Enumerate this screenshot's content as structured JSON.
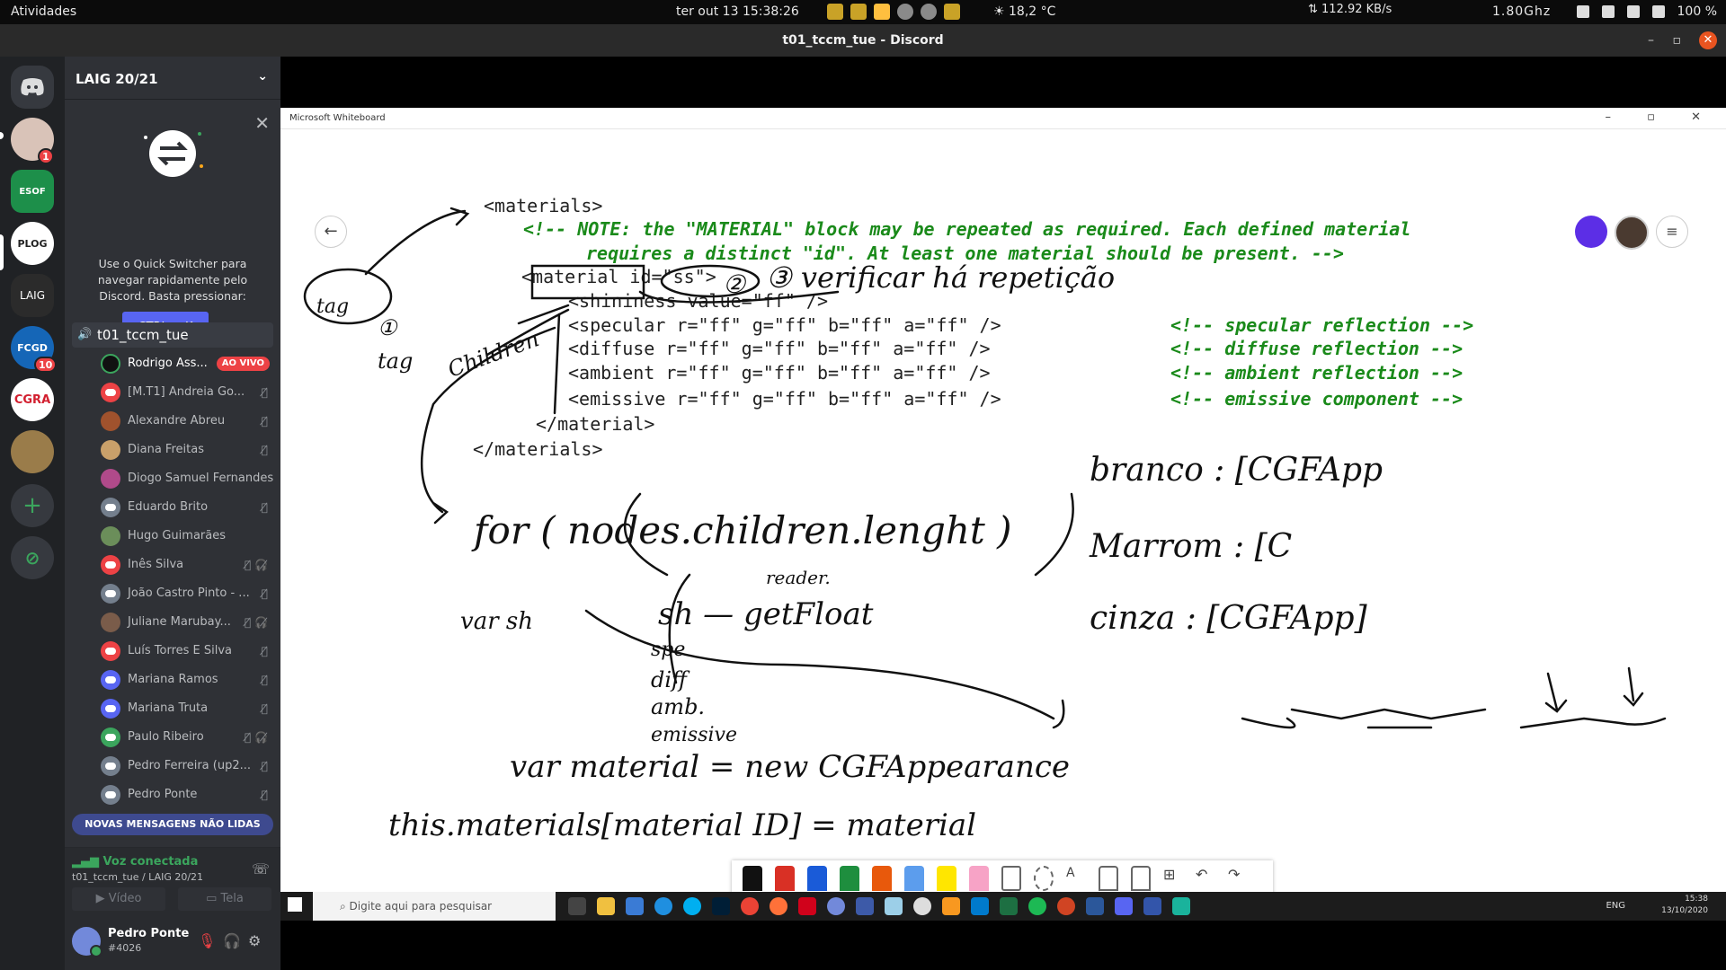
{
  "topbar": {
    "activities": "Atividades",
    "clock": "ter out 13  15:38:26",
    "weather": "☀ 18,2 °C",
    "net_speed": "⇅ 112.92 KB/s",
    "cpu": "1.80Ghz",
    "battery": "100 %"
  },
  "window": {
    "title": "t01_tccm_tue - Discord"
  },
  "rail": {
    "servers": [
      {
        "label": "",
        "badge": "1"
      },
      {
        "label": "ESOF"
      },
      {
        "label": "PLOG"
      },
      {
        "label": "LAIG"
      },
      {
        "label": "FCGD",
        "badge": "10"
      },
      {
        "label": "CGRA"
      },
      {
        "label": ""
      }
    ]
  },
  "sidebar": {
    "guild_name": "LAIG 20/21",
    "switcher": {
      "text": "Use o Quick Switcher para navegar rapidamente pelo Discord. Basta pressionar:",
      "button": "CTRL + K"
    },
    "voice_channel": "t01_tccm_tue",
    "live_label": "AO VIVO",
    "voice_users": [
      {
        "name": "Rodrigo Ass...",
        "live": true,
        "color": "#111111"
      },
      {
        "name": "[M.T1] Andreia Go...",
        "color": "#ed4245"
      },
      {
        "name": "Alexandre Abreu",
        "color": "#a0522d"
      },
      {
        "name": "Diana Freitas",
        "color": "#c9a06a"
      },
      {
        "name": "Diogo Samuel Fernandes",
        "color": "#b04a8a"
      },
      {
        "name": "Eduardo Brito",
        "color": "#747f8d"
      },
      {
        "name": "Hugo Guimarães",
        "color": "#6b8e5a"
      },
      {
        "name": "Inês Silva",
        "color": "#ed4245"
      },
      {
        "name": "João Castro Pinto - ...",
        "color": "#747f8d"
      },
      {
        "name": "Juliane Marubay...",
        "color": "#7a5c4a"
      },
      {
        "name": "Luís Torres E Silva",
        "color": "#ed4245"
      },
      {
        "name": "Mariana Ramos",
        "color": "#5865f2"
      },
      {
        "name": "Mariana Truta",
        "color": "#5865f2"
      },
      {
        "name": "Paulo Ribeiro",
        "color": "#3ba55d"
      },
      {
        "name": "Pedro Ferreira (up2...",
        "color": "#747f8d"
      },
      {
        "name": "Pedro Ponte",
        "color": "#747f8d"
      }
    ],
    "new_messages": "NOVAS MENSAGENS NÃO LIDAS",
    "voice_panel": {
      "status": "Voz conectada",
      "path": "t01_tccm_tue / LAIG 20/21",
      "video": "Vídeo",
      "screen": "Tela"
    },
    "user": {
      "name": "Pedro Ponte",
      "tag": "#4026"
    }
  },
  "whiteboard": {
    "app_title": "Microsoft Whiteboard",
    "code_lines": [
      "<materials>",
      "<material id=\"ss\">",
      "<shininess value=\"ff\" />",
      "<specular r=\"ff\" g=\"ff\" b=\"ff\" a=\"ff\" />",
      "<diffuse r=\"ff\" g=\"ff\" b=\"ff\" a=\"ff\" />",
      "<ambient r=\"ff\" g=\"ff\" b=\"ff\" a=\"ff\" />",
      "<emissive r=\"ff\" g=\"ff\" b=\"ff\" a=\"ff\" />",
      "</material>",
      "</materials>"
    ],
    "comments": [
      "<!-- NOTE: the \"MATERIAL\" block may be repeated as required. Each defined material",
      "requires a distinct \"id\". At least one material should be present. -->",
      "<!-- specular reflection -->",
      "<!-- diffuse reflection -->",
      "<!-- ambient reflection -->",
      "<!-- emissive component -->"
    ],
    "handwriting": [
      "tag",
      "①",
      "tag",
      "Children",
      "②",
      "③ verificar há repetição",
      "for ( nodes.children.lenght )",
      "var sh",
      "reader.",
      "sh — getFloat",
      "spe",
      "diff",
      "amb.",
      "emissive",
      "var material = new CGFAppearance",
      "this.materials[material ID] = material",
      "branco : [CGFApp",
      "Marrom : [C",
      "cinza : [CGFApp]"
    ]
  },
  "taskbar": {
    "search_placeholder": "Digite aqui para pesquisar",
    "lang": "ENG",
    "time": "15:38",
    "date": "13/10/2020"
  }
}
